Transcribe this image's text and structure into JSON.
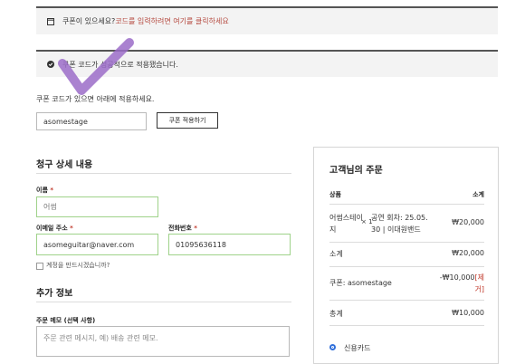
{
  "notice_coupon": {
    "text": "쿠폰이 있으세요? ",
    "link": "코드를 입력하려면 여기를 클릭하세요"
  },
  "notice_success": {
    "text": "쿠폰 코드가 성공적으로 적용됐습니다."
  },
  "coupon_form": {
    "prompt": "쿠폰 코드가 있으면 아래에 적용하세요.",
    "code_value": "asomestage",
    "apply_label": "쿠폰 적용하기"
  },
  "billing": {
    "title": "청구 상세 내용",
    "name_label": "이름",
    "name_value": "어썸",
    "email_label": "이메일 주소",
    "email_value": "asomeguitar@naver.com",
    "phone_label": "전화번호",
    "phone_value": "01095636118",
    "create_account_label": "계정을 만드시겠습니까?",
    "required_mark": "*"
  },
  "additional": {
    "title": "추가 정보",
    "notes_label": "주문 메모 (선택 사항)",
    "notes_placeholder": "주문 관련 메시지, 예) 배송 관련 메모."
  },
  "order": {
    "title": "고객님의 주문",
    "col_product": "상품",
    "col_subtotal": "소계",
    "item_name_1": "어썸스테이",
    "item_name_2": "지",
    "item_qty": "× 1",
    "item_meta_1": "공연 회차: 25.05.",
    "item_meta_2": "30 | 이대원밴드",
    "item_price": "₩20,000",
    "subtotal_label": "소계",
    "subtotal_value": "₩20,000",
    "coupon_label": "쿠폰: asomestage",
    "coupon_value": "-₩10,000",
    "coupon_remove_1": "[제",
    "coupon_remove_2": "거]",
    "total_label": "총계",
    "total_value": "₩10,000",
    "payment_label": "신용카드"
  },
  "colors": {
    "accent_red": "#c0392b",
    "check_stroke": "#9b6cc8",
    "valid_border": "#9fd28a"
  }
}
